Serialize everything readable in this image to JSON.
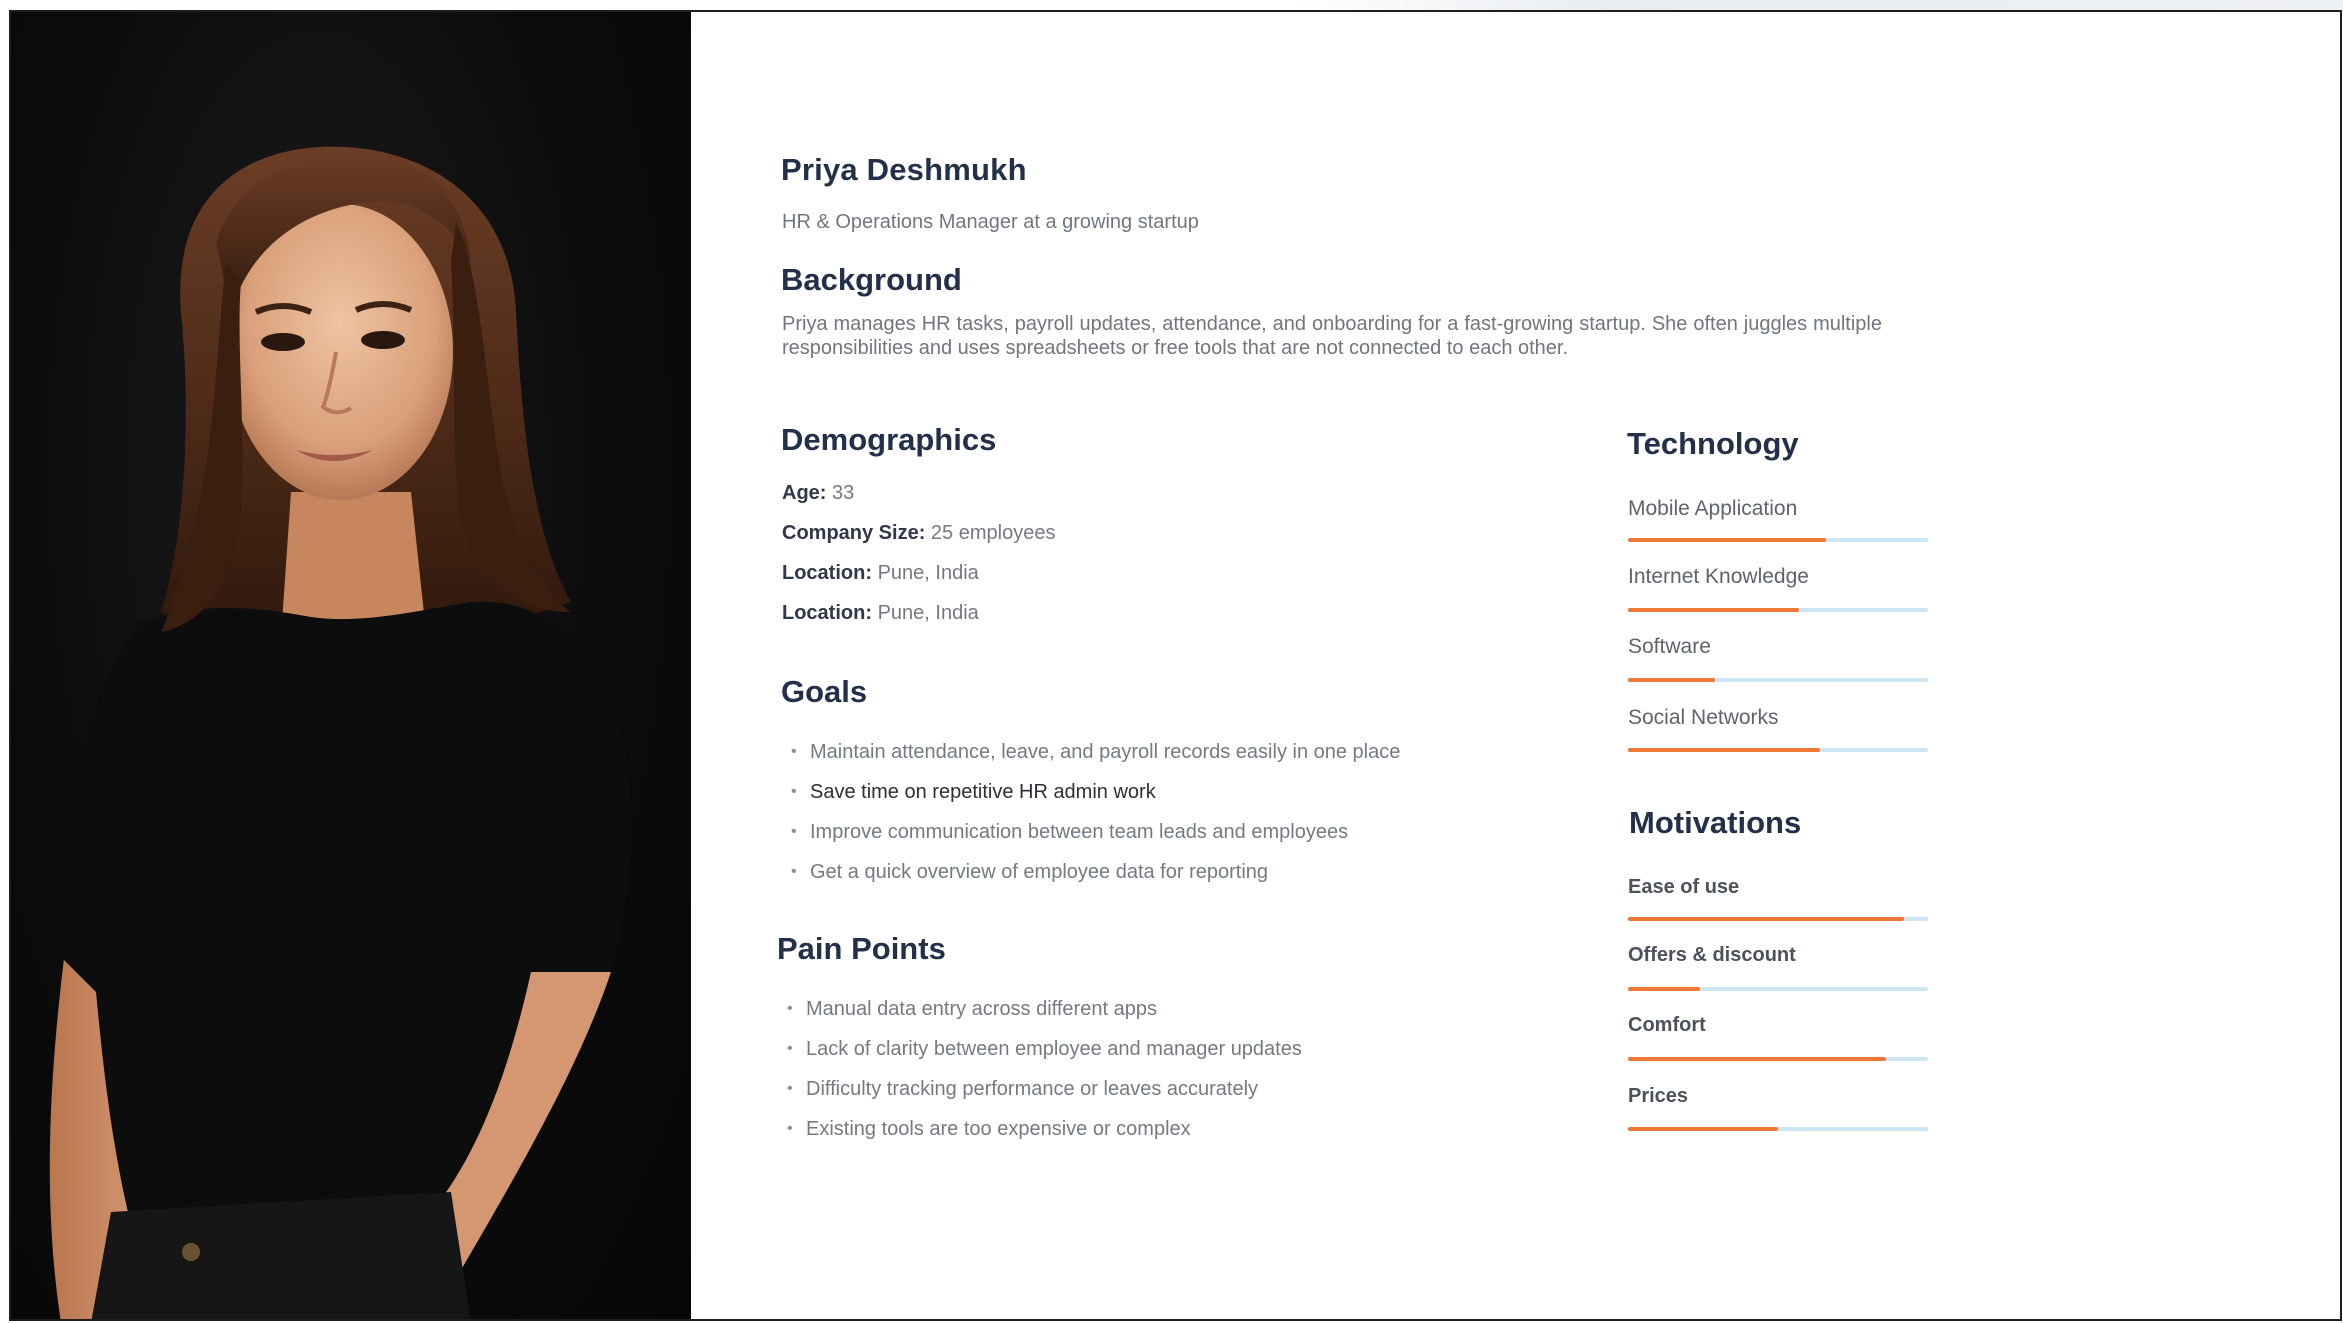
{
  "persona": {
    "name": "Priya Deshmukh",
    "role": "HR & Operations Manager at a growing startup"
  },
  "background": {
    "heading": "Background",
    "text": "Priya manages HR tasks, payroll updates, attendance, and onboarding for a fast-growing startup. She often juggles multiple responsibilities and uses spreadsheets or free tools that are not connected to each other."
  },
  "demographics": {
    "heading": "Demographics",
    "rows": [
      {
        "label": "Age:",
        "value": "33"
      },
      {
        "label": "Company Size:",
        "value": "25 employees"
      },
      {
        "label": "Location:",
        "value": "Pune, India"
      },
      {
        "label": "Location:",
        "value": "Pune, India"
      }
    ]
  },
  "goals": {
    "heading": "Goals",
    "items": [
      "Maintain attendance, leave, and payroll records easily in one place",
      "Save time on repetitive HR admin work",
      "Improve communication between team leads and employees",
      "Get a quick overview of employee data for reporting"
    ]
  },
  "pain_points": {
    "heading": "Pain Points",
    "items": [
      "Manual data entry across different apps",
      "Lack of clarity between employee and manager updates",
      "Difficulty tracking performance or leaves accurately",
      "Existing tools are too expensive or complex"
    ]
  },
  "technology": {
    "heading": "Technology",
    "items": [
      {
        "label": "Mobile Application",
        "level": 0.66
      },
      {
        "label": "Internet Knowledge",
        "level": 0.57
      },
      {
        "label": "Software",
        "level": 0.29
      },
      {
        "label": "Social Networks",
        "level": 0.64
      }
    ]
  },
  "motivations": {
    "heading": "Motivations",
    "items": [
      {
        "label": "Ease of use",
        "level": 0.92
      },
      {
        "label": "Offers & discount",
        "level": 0.24
      },
      {
        "label": "Comfort",
        "level": 0.86
      },
      {
        "label": "Prices",
        "level": 0.5
      }
    ]
  },
  "colors": {
    "heading": "#22304a",
    "bar_fill": "#f07836",
    "bar_track": "#cde7f2"
  }
}
